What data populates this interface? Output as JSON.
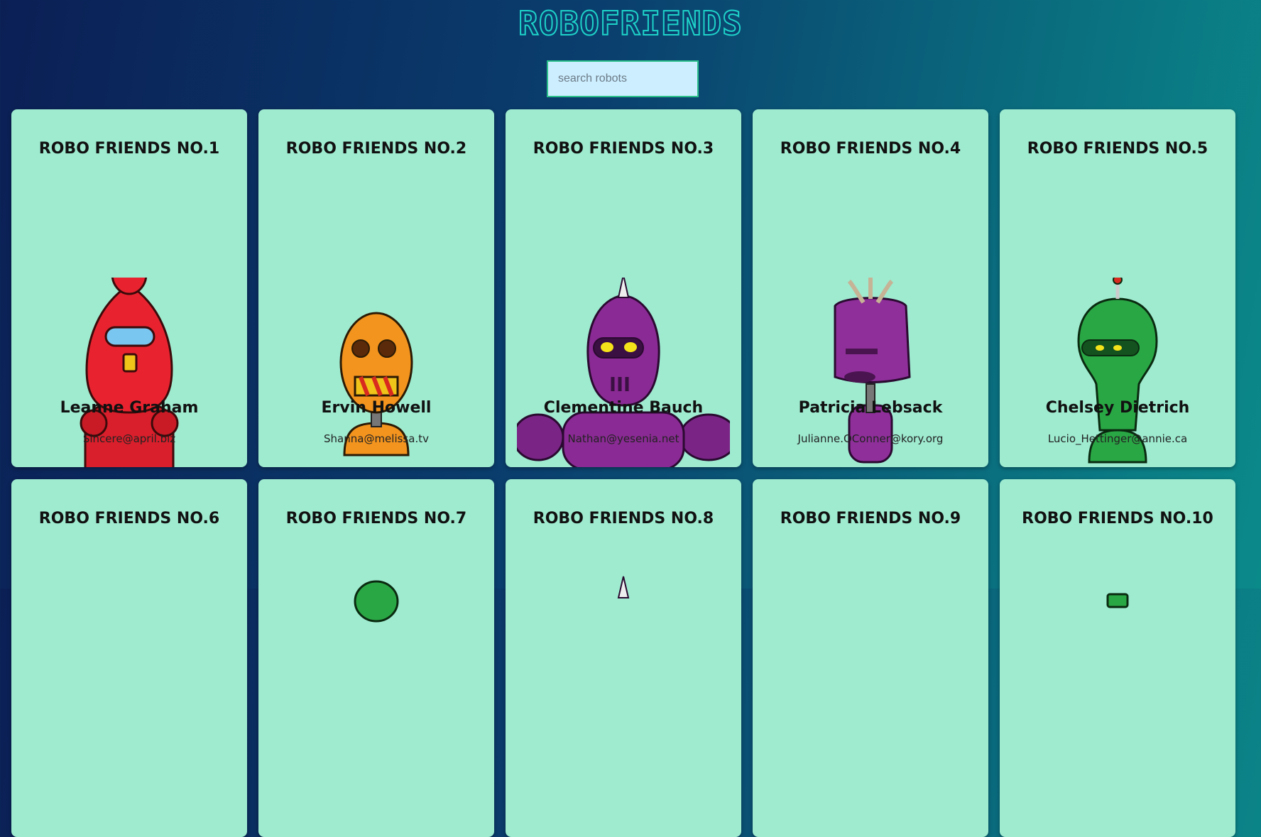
{
  "header": {
    "title": "ROBOFRIENDS"
  },
  "search": {
    "placeholder": "search robots",
    "value": ""
  },
  "cards": [
    {
      "label": "ROBO FRIENDS NO.1",
      "name": "Leanne Graham",
      "email": "Sincere@april.biz",
      "color": "#e8232f",
      "icon": "red-robot-icon"
    },
    {
      "label": "ROBO FRIENDS NO.2",
      "name": "Ervin Howell",
      "email": "Shanna@melissa.tv",
      "color": "#f3941e",
      "icon": "orange-robot-icon"
    },
    {
      "label": "ROBO FRIENDS NO.3",
      "name": "Clementine Bauch",
      "email": "Nathan@yesenia.net",
      "color": "#8a2a94",
      "icon": "purple-robot-icon"
    },
    {
      "label": "ROBO FRIENDS NO.4",
      "name": "Patricia Lebsack",
      "email": "Julianne.OConner@kory.org",
      "color": "#8f2f9a",
      "icon": "purple-robot-icon"
    },
    {
      "label": "ROBO FRIENDS NO.5",
      "name": "Chelsey Dietrich",
      "email": "Lucio_Hettinger@annie.ca",
      "color": "#2aa745",
      "icon": "green-robot-icon"
    },
    {
      "label": "ROBO FRIENDS NO.6"
    },
    {
      "label": "ROBO FRIENDS NO.7"
    },
    {
      "label": "ROBO FRIENDS NO.8"
    },
    {
      "label": "ROBO FRIENDS NO.9"
    },
    {
      "label": "ROBO FRIENDS NO.10"
    }
  ]
}
